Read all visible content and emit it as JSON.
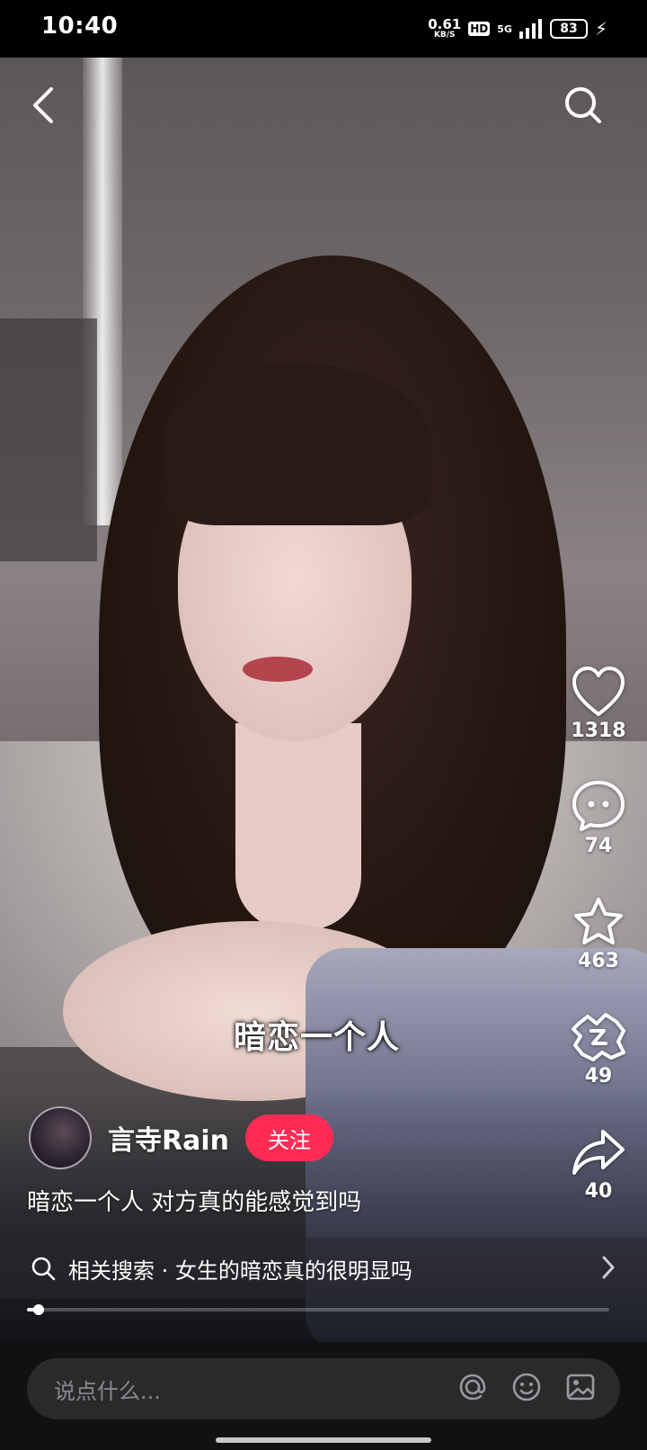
{
  "status_bar": {
    "time": "10:40",
    "net_speed_value": "0.61",
    "net_speed_unit": "KB/S",
    "hd_label": "HD",
    "network_label": "5G",
    "battery": "83"
  },
  "video": {
    "subtitle": "暗恋一个人"
  },
  "actions": {
    "likes": "1318",
    "comments": "74",
    "favorites": "463",
    "recommend": "49",
    "shares": "40"
  },
  "author": {
    "name": "言寺Rain",
    "follow_label": "关注"
  },
  "caption": "暗恋一个人 对方真的能感觉到吗",
  "related_search": {
    "label": "相关搜索 · 女生的暗恋真的很明显吗"
  },
  "playback": {
    "progress": 0.02
  },
  "comment_bar": {
    "placeholder": "说点什么..."
  },
  "colors": {
    "follow_button": "#fe2c55",
    "background": "#000000"
  }
}
